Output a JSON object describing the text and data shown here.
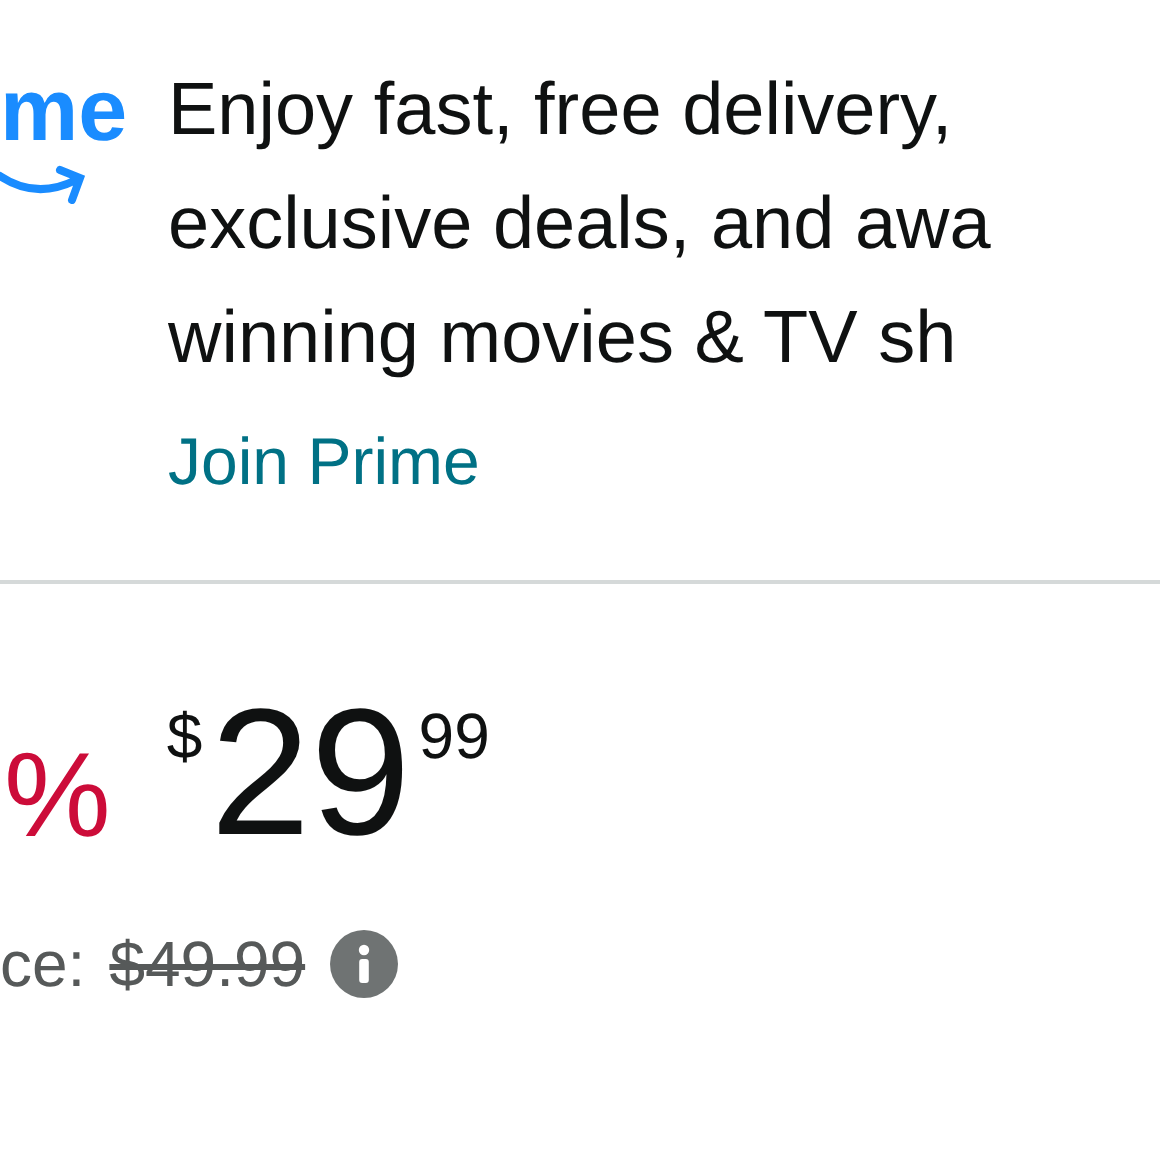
{
  "prime_promo": {
    "logo_text": "me",
    "lines": [
      "Enjoy fast, free delivery,",
      "exclusive deals, and awa",
      "winning movies & TV sh"
    ],
    "link": "Join Prime"
  },
  "price": {
    "discount": "%",
    "currency": "$",
    "whole": "29",
    "fraction": "99",
    "list_label": "ce:",
    "list_price": "$49.99"
  }
}
